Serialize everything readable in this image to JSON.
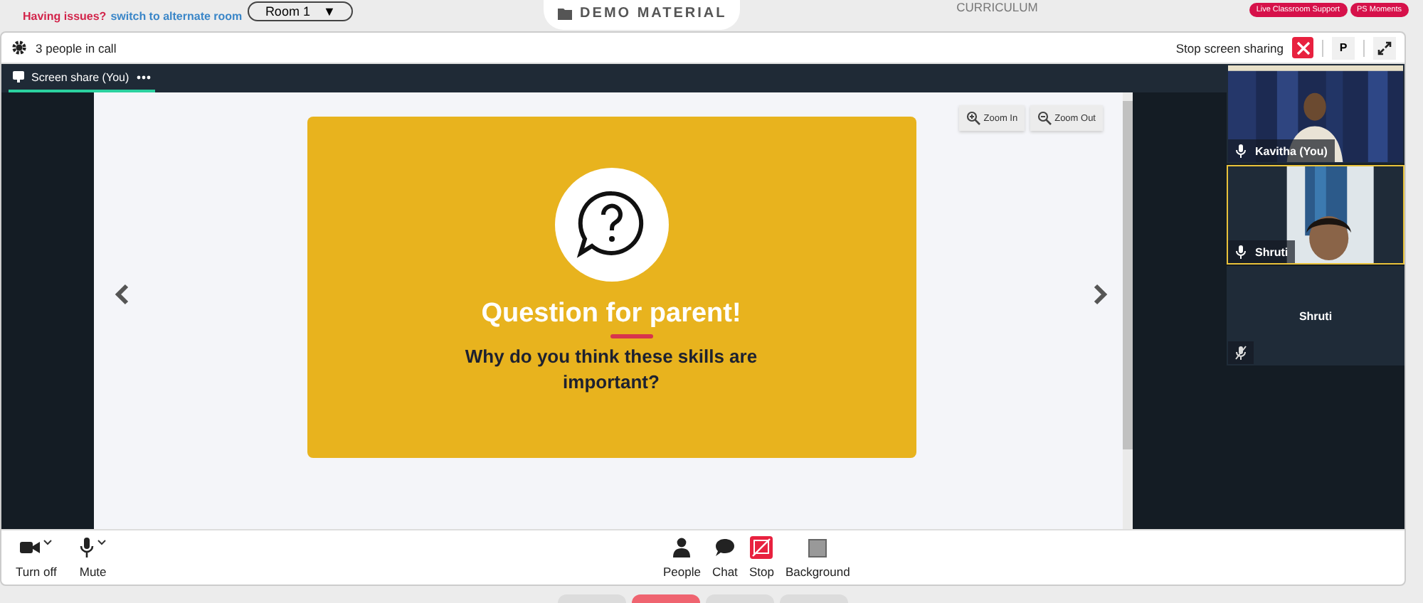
{
  "top_bar": {
    "issue_text": "Having issues?",
    "alternate_link": "switch to alternate room",
    "room_select": {
      "value": "Room 1",
      "arrow": "▼"
    },
    "demo_material": "DEMO MATERIAL",
    "curriculum": "CURRICULUM",
    "badges": [
      "Live Classroom Support",
      "PS Moments"
    ]
  },
  "call_header": {
    "people_count": "3 people in call",
    "stop_label": "Stop screen sharing",
    "p_button": "P"
  },
  "tabs": [
    {
      "label": "Screen share (You)",
      "selected": true
    }
  ],
  "slide": {
    "zoom_buttons": [
      "Zoom In",
      "Zoom Out"
    ],
    "title": "Question for parent!",
    "question": "Why do you think these skills are important?"
  },
  "participants": [
    {
      "name": "Kavitha (You)",
      "kind": "video",
      "speaking": false,
      "muted": false
    },
    {
      "name": "Shruti",
      "kind": "video",
      "speaking": true,
      "muted": false
    },
    {
      "name": "Shruti",
      "kind": "avatar",
      "speaking": false,
      "muted": true
    }
  ],
  "toolbar": {
    "left": [
      {
        "label": "Turn off",
        "kind": "camera"
      },
      {
        "label": "Mute",
        "kind": "mic"
      }
    ],
    "center": [
      {
        "label": "People",
        "kind": "people"
      },
      {
        "label": "Chat",
        "kind": "chat"
      },
      {
        "label": "Stop",
        "kind": "stop"
      },
      {
        "label": "Background",
        "kind": "background"
      }
    ]
  },
  "bottom_tabs": [
    {
      "color": "#dcdcdc"
    },
    {
      "color": "#ef6470"
    },
    {
      "color": "#dcdcdc"
    },
    {
      "color": "#dcdcdc"
    }
  ]
}
